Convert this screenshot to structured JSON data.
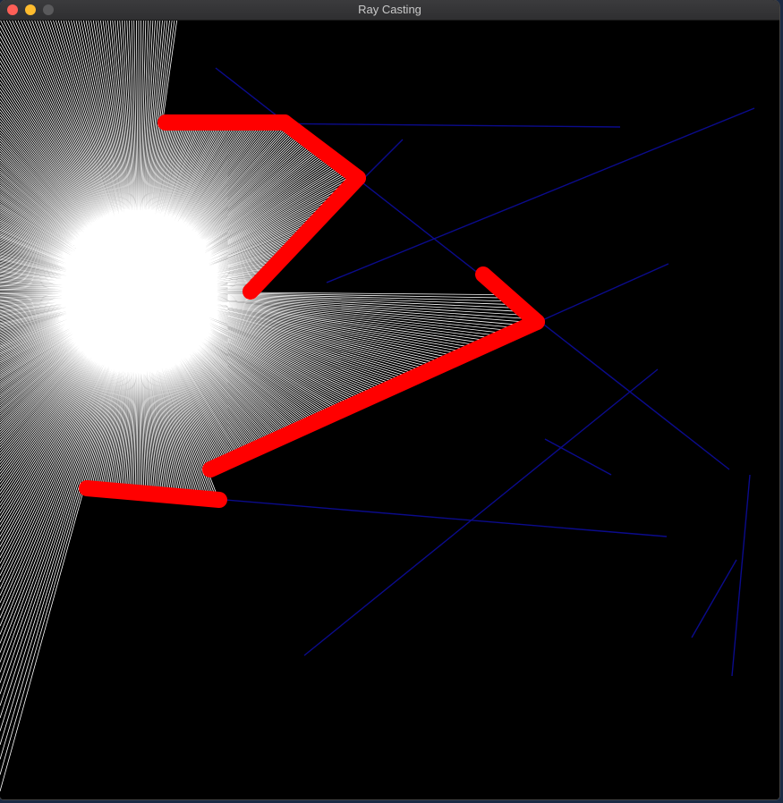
{
  "window": {
    "title": "Ray Casting",
    "controls": [
      "close",
      "minimize",
      "zoom"
    ]
  },
  "scene": {
    "background_color": "#000000",
    "ray_color": "#ffffff",
    "wall_color": "#0b0b8c",
    "hit_color": "#ff0000",
    "ray_count": 720
  }
}
